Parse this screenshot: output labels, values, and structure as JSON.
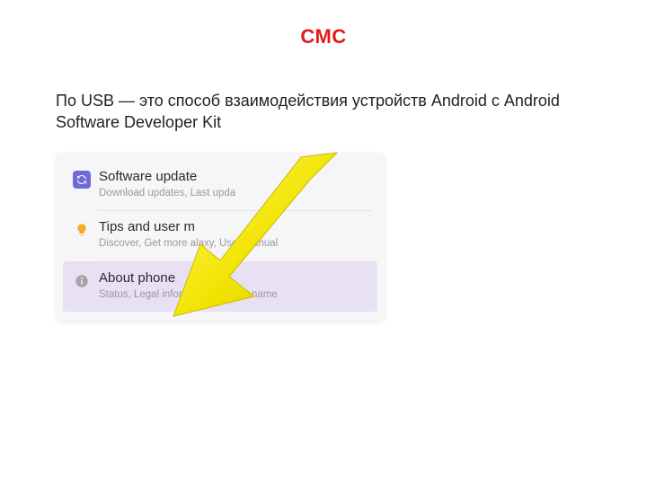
{
  "title": "СМС",
  "body_text": "По USB — это способ взаимодействия устройств Android с Android Software Developer Kit",
  "card": {
    "rows": [
      {
        "icon": "update-icon",
        "title": "Software update",
        "subtitle": "Download updates, Last upda",
        "highlight": false
      },
      {
        "icon": "tips-icon",
        "title": "Tips and user m",
        "subtitle": "Discover, Get more            alaxy, User manual",
        "highlight": false
      },
      {
        "icon": "info-icon",
        "title": "About phone",
        "subtitle": "Status, Legal information, Phone name",
        "highlight": true
      }
    ]
  },
  "colors": {
    "title_red": "#e11b1b",
    "arrow_yellow": "#f2e400",
    "highlight_row": "#e8e1f4",
    "update_icon_bg": "#6d6bd8",
    "tips_icon": "#f7a92b",
    "info_icon": "#a5a3a8"
  }
}
